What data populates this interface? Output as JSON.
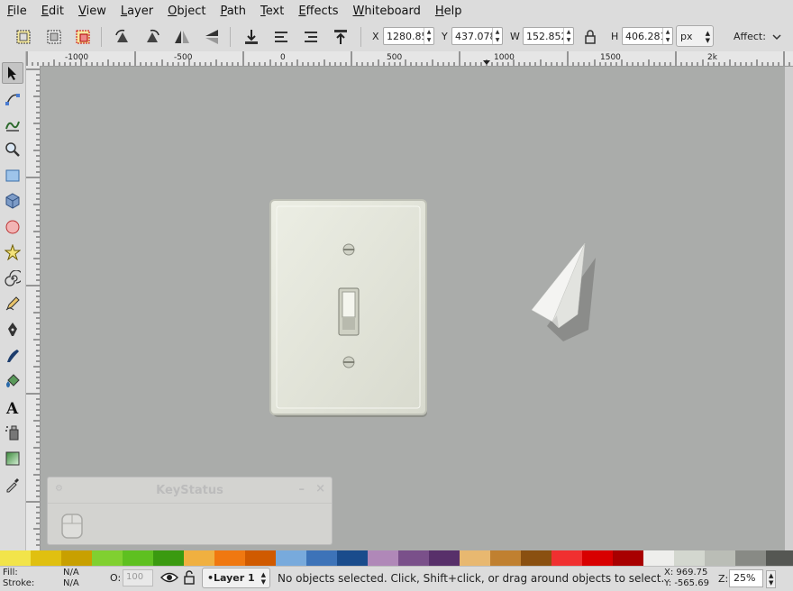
{
  "menu": [
    "File",
    "Edit",
    "View",
    "Layer",
    "Object",
    "Path",
    "Text",
    "Effects",
    "Whiteboard",
    "Help"
  ],
  "controls": {
    "x_label": "X",
    "x_value": "1280.85",
    "y_label": "Y",
    "y_value": "437.078",
    "w_label": "W",
    "w_value": "152.852",
    "h_label": "H",
    "h_value": "406.281",
    "unit": "px",
    "affect_label": "Affect:"
  },
  "ruler": {
    "h_labels": [
      "-1000",
      "-500",
      "0",
      "500",
      "1000",
      "1500",
      "2k"
    ]
  },
  "keystatus": {
    "title": "KeyStatus",
    "minimize": "–",
    "close": "×"
  },
  "palette": [
    "#f2e44a",
    "#e0c010",
    "#c8a000",
    "#80d030",
    "#5ec020",
    "#3a9a10",
    "#f0b040",
    "#f07810",
    "#d05a00",
    "#78aadc",
    "#3d73b8",
    "#1a4c8c",
    "#b088b8",
    "#7a508a",
    "#58306a",
    "#e8b870",
    "#c08030",
    "#8a5010",
    "#f03030",
    "#d80000",
    "#a80000",
    "#eeeeec",
    "#d3d7cf",
    "#babdb6",
    "#888a85",
    "#555753",
    "#2e3436"
  ],
  "status": {
    "fill_label": "Fill:",
    "fill_value": "N/A",
    "stroke_label": "Stroke:",
    "stroke_value": "N/A",
    "opacity_label": "O:",
    "opacity_value": "100",
    "layer": "•Layer 1",
    "message": "No objects selected. Click, Shift+click, or drag around objects to select.",
    "x_readout": "X:  969.75",
    "y_readout": "Y: -565.69",
    "zoom_label": "Z:",
    "zoom_value": "25%"
  }
}
